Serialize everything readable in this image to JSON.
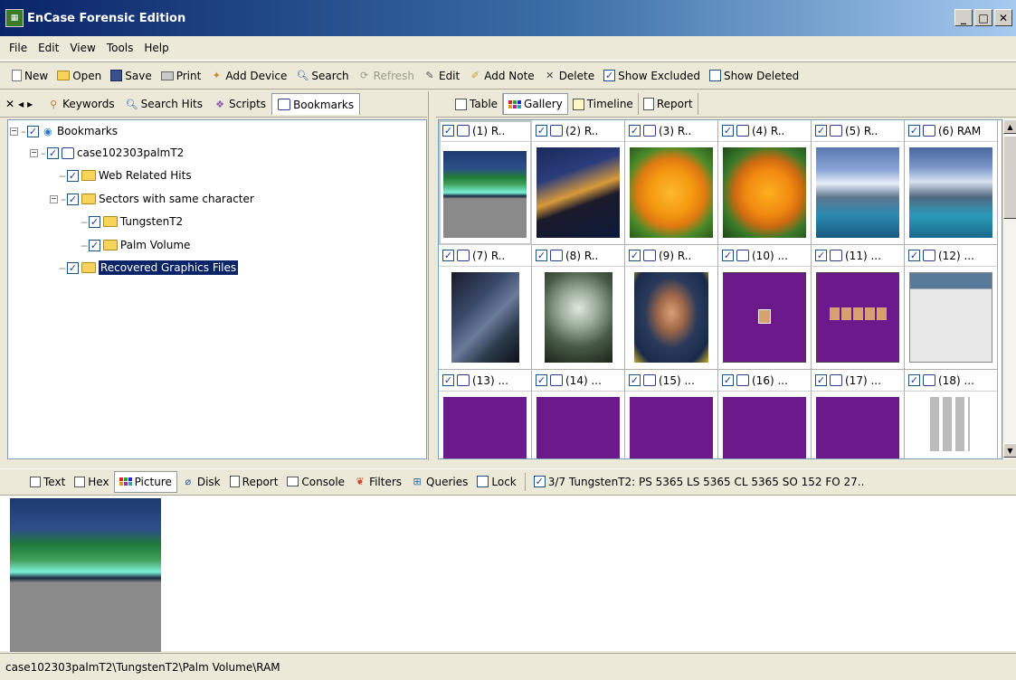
{
  "window": {
    "title": "EnCase Forensic Edition"
  },
  "menu": [
    "File",
    "Edit",
    "View",
    "Tools",
    "Help"
  ],
  "toolbar": {
    "new": "New",
    "open": "Open",
    "save": "Save",
    "print": "Print",
    "add_device": "Add Device",
    "search": "Search",
    "refresh": "Refresh",
    "edit": "Edit",
    "add_note": "Add Note",
    "delete": "Delete",
    "show_excluded": "Show Excluded",
    "show_deleted": "Show Deleted"
  },
  "left_tabs": {
    "keywords": "Keywords",
    "search_hits": "Search Hits",
    "scripts": "Scripts",
    "bookmarks": "Bookmarks"
  },
  "tree": {
    "root": "Bookmarks",
    "case": "case102303palmT2",
    "web": "Web Related Hits",
    "sectors": "Sectors with same character",
    "tungsten": "TungstenT2",
    "palm": "Palm Volume",
    "recovered": "Recovered Graphics Files"
  },
  "right_tabs": {
    "table": "Table",
    "gallery": "Gallery",
    "timeline": "Timeline",
    "report": "Report"
  },
  "gallery": {
    "captions": [
      "(1) R..",
      "(2) R..",
      "(3) R..",
      "(4) R..",
      "(5) R..",
      "(6) RAM",
      "(7) R..",
      "(8) R..",
      "(9) R..",
      "(10) ...",
      "(11) ...",
      "(12) ...",
      "(13) ...",
      "(14) ...",
      "(15) ...",
      "(16) ...",
      "(17) ...",
      "(18) ..."
    ]
  },
  "view_tabs": {
    "text": "Text",
    "hex": "Hex",
    "picture": "Picture",
    "disk": "Disk",
    "report": "Report",
    "console": "Console",
    "filters": "Filters",
    "queries": "Queries",
    "lock": "Lock",
    "info": "3/7  TungstenT2: PS 5365  LS 5365  CL 5365  SO 152  FO 27.."
  },
  "status": {
    "path": "case102303palmT2\\TungstenT2\\Palm Volume\\RAM"
  }
}
